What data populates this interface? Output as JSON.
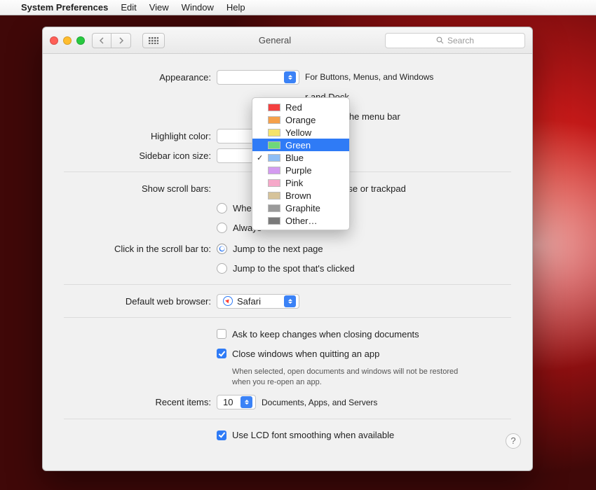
{
  "menubar": {
    "apple": "",
    "app": "System Preferences",
    "items": [
      "Edit",
      "View",
      "Window",
      "Help"
    ]
  },
  "window": {
    "title": "General",
    "search_placeholder": "Search"
  },
  "appearance": {
    "label": "Appearance:",
    "note": "For Buttons, Menus, and Windows",
    "dark_menu": "r and Dock",
    "auto_hide": "and show the menu bar"
  },
  "highlight": {
    "label": "Highlight color:"
  },
  "sidebar": {
    "label": "Sidebar icon size:"
  },
  "scrollbars": {
    "label": "Show scroll bars:",
    "opt1_partial": "ed on mouse or trackpad",
    "opt2": "When scrolling",
    "opt3": "Always"
  },
  "scrollclick": {
    "label": "Click in the scroll bar to:",
    "opt1": "Jump to the next page",
    "opt2": "Jump to the spot that's clicked"
  },
  "browser": {
    "label": "Default web browser:",
    "value": "Safari"
  },
  "docs": {
    "ask": "Ask to keep changes when closing documents",
    "close": "Close windows when quitting an app",
    "close_help": "When selected, open documents and windows will not be restored when you re-open an app."
  },
  "recent": {
    "label": "Recent items:",
    "value": "10",
    "note": "Documents, Apps, and Servers"
  },
  "lcd": {
    "label": "Use LCD font smoothing when available"
  },
  "help": "?",
  "dropdown": {
    "items": [
      {
        "name": "Red",
        "color": "#f44040",
        "selected": false,
        "checked": false
      },
      {
        "name": "Orange",
        "color": "#f5a04a",
        "selected": false,
        "checked": false
      },
      {
        "name": "Yellow",
        "color": "#f6e36a",
        "selected": false,
        "checked": false
      },
      {
        "name": "Green",
        "color": "#6fd87a",
        "selected": true,
        "checked": false
      },
      {
        "name": "Blue",
        "color": "#8fbef5",
        "selected": false,
        "checked": true
      },
      {
        "name": "Purple",
        "color": "#d49bf0",
        "selected": false,
        "checked": false
      },
      {
        "name": "Pink",
        "color": "#f6a8c9",
        "selected": false,
        "checked": false
      },
      {
        "name": "Brown",
        "color": "#d6c39a",
        "selected": false,
        "checked": false
      },
      {
        "name": "Graphite",
        "color": "#9a9a9a",
        "selected": false,
        "checked": false
      },
      {
        "name": "Other…",
        "color": "#7a7a7a",
        "selected": false,
        "checked": false
      }
    ]
  }
}
